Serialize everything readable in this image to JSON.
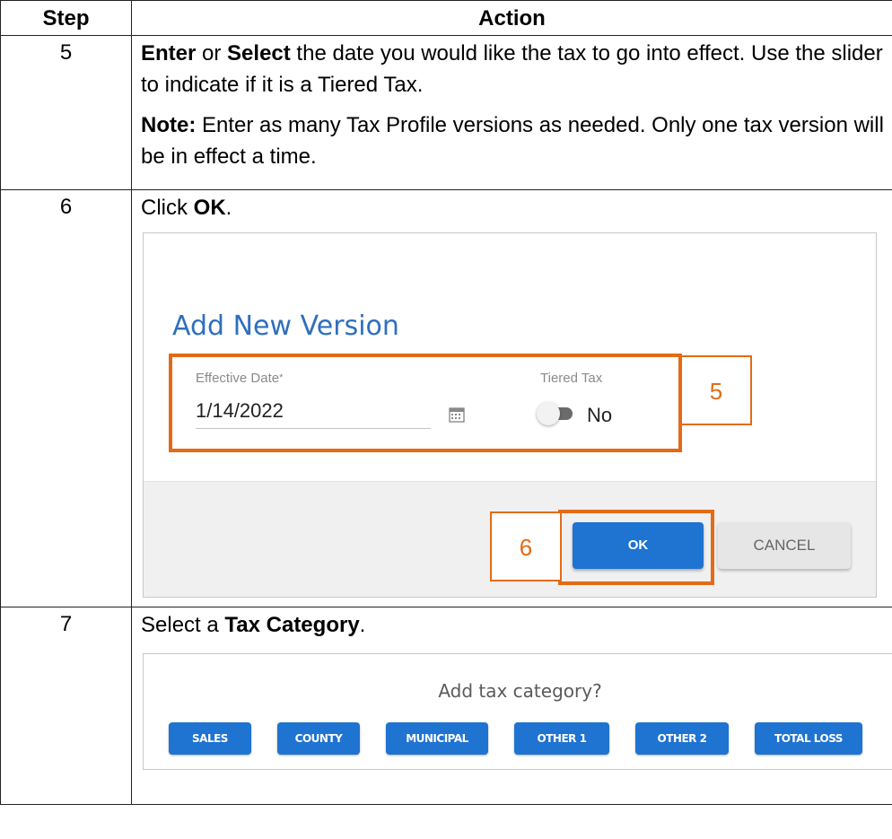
{
  "table": {
    "header_step": "Step",
    "header_action": "Action"
  },
  "rows": {
    "r5": {
      "step": "5",
      "p1_b1": "Enter",
      "p1_t1": " or ",
      "p1_b2": "Select",
      "p1_t2": " the date you would like the tax to go into effect. Use the slider to indicate if it is a Tiered Tax.",
      "p2_b": "Note:",
      "p2_t": " Enter as many Tax Profile versions as needed. Only one tax version will be in effect a time."
    },
    "r6": {
      "step": "6",
      "t1": "Click ",
      "b": "OK",
      "t2": "."
    },
    "r7": {
      "step": "7",
      "t1": "Select a ",
      "b": "Tax Category",
      "t2": "."
    }
  },
  "dialog": {
    "title": "Add New Version",
    "date_label": "Effective Date",
    "required_mark": "*",
    "date_value": "1/14/2022",
    "tiered_label": "Tiered Tax",
    "tiered_value": "No",
    "tiered_on": false,
    "ok": "OK",
    "cancel": "CANCEL",
    "callout5": "5",
    "callout6": "6",
    "accent": "#e36b15",
    "button_blue": "#1f73d1"
  },
  "category": {
    "question": "Add tax category?",
    "buttons": [
      "SALES",
      "COUNTY",
      "MUNICIPAL",
      "OTHER 1",
      "OTHER 2",
      "TOTAL LOSS"
    ]
  }
}
